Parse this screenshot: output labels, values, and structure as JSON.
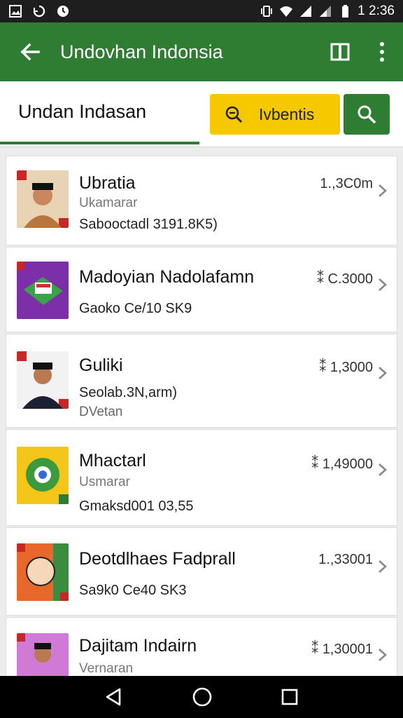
{
  "status": {
    "time": "1 2:36"
  },
  "appbar": {
    "title": "Undovhan Indonsia"
  },
  "header": {
    "title": "Undan Indasan",
    "filter_label": "Ivbentis"
  },
  "items": [
    {
      "name": "Ubratia",
      "sub": "Ukamarar",
      "meta": "Sabooctadl ‪3191.8K5)",
      "price": "1.,3C0m"
    },
    {
      "name": "Madoyian Nadolafamn",
      "sub": "",
      "meta": "Gaoko Ce/10 SK9",
      "price": "⁑ C.3000"
    },
    {
      "name": "Guliki",
      "sub": "Seolab.3N,arm)",
      "meta": "DVetan",
      "price": "⁑ 1,3000"
    },
    {
      "name": "Mhactarl",
      "sub": "Usmarar",
      "meta": "Gmaksd001 03,55",
      "price": "⁑ 1,49000"
    },
    {
      "name": "Deotdlhaes Fadprall",
      "sub": "",
      "meta": "Sa9k0 Ce40 SK3",
      "price": "1.,33001"
    },
    {
      "name": "Dajitam Indairn",
      "sub": "Vernaran",
      "meta": "",
      "price": "⁑ 1,30001"
    }
  ]
}
